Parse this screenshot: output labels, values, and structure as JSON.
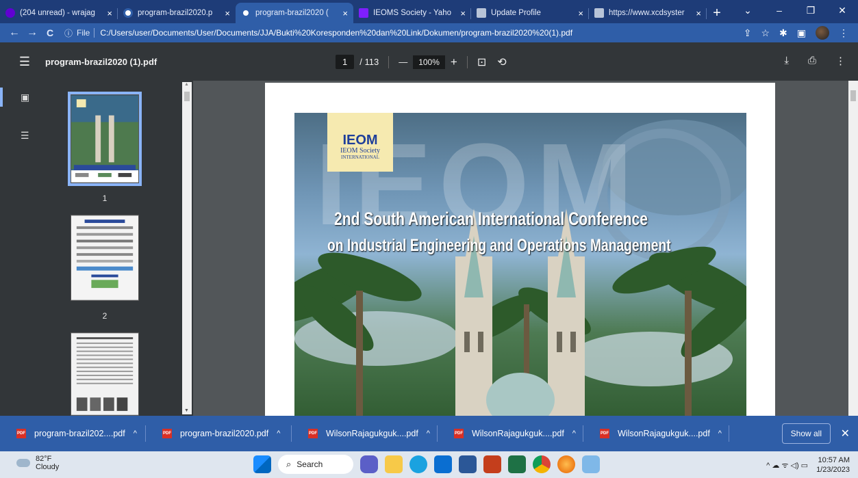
{
  "tabs": [
    {
      "title": "(204 unread) - wrajag",
      "favicon_color": "#6001d2",
      "active": false
    },
    {
      "title": "program-brazil2020.p",
      "favicon_color": "#ffffff",
      "active": false
    },
    {
      "title": "program-brazil2020 (",
      "favicon_color": "#ffffff",
      "active": true
    },
    {
      "title": "IEOMS Society - Yaho",
      "favicon_color": "#7e1fff",
      "active": false
    },
    {
      "title": "Update Profile",
      "favicon_color": "#b8c4d8",
      "active": false
    },
    {
      "title": "https://www.xcdsyster",
      "favicon_color": "#b8c4d8",
      "active": false
    }
  ],
  "tab_close": "×",
  "new_tab": "+",
  "window_controls": {
    "chevron": "⌄",
    "minimize": "–",
    "restore": "❐",
    "close": "✕"
  },
  "nav": {
    "back": "←",
    "forward": "→",
    "reload": "C"
  },
  "address": {
    "info_icon": "ⓘ",
    "scheme": "File",
    "url": "C:/Users/user/Documents/User/Documents/JJA/Bukti%20Koresponden%20dan%20Link/Dokumen/program-brazil2020%20(1).pdf"
  },
  "toolbar_icons": {
    "share": "⇪",
    "star": "☆",
    "extensions": "✱",
    "sidepanel": "▣",
    "menu": "⋮"
  },
  "pdf": {
    "menu_icon": "☰",
    "filename": "program-brazil2020 (1).pdf",
    "current_page": "1",
    "total_pages": "/ 113",
    "zoom_out": "—",
    "zoom": "100%",
    "zoom_in": "+",
    "fit_icon": "⊡",
    "rotate_icon": "⟲",
    "download_icon": "⤓",
    "print_icon": "⎙",
    "more_icon": "⋮"
  },
  "sidebar": {
    "thumbnails_icon": "▣",
    "outline_icon": "☰",
    "thumbs": [
      {
        "label": "1",
        "selected": true
      },
      {
        "label": "2",
        "selected": false
      },
      {
        "label": "",
        "selected": false
      }
    ],
    "scroll_up": "▲",
    "scroll_down": "▼"
  },
  "cover": {
    "logo_main": "IEOM",
    "logo_sub1": "IEOM Society",
    "logo_sub2": "INTERNATIONAL",
    "watermark": "IEOM",
    "title_line1": "2nd South American International Conference",
    "title_line2": "on Industrial Engineering and Operations Management"
  },
  "downloads": [
    {
      "name": "program-brazil202....pdf"
    },
    {
      "name": "program-brazil2020.pdf"
    },
    {
      "name": "WilsonRajagukguk....pdf"
    },
    {
      "name": "WilsonRajagukguk....pdf"
    },
    {
      "name": "WilsonRajagukguk....pdf"
    }
  ],
  "download_icon_text": "PDF",
  "download_chevron": "^",
  "show_all": "Show all",
  "downloads_close": "✕",
  "taskbar": {
    "temperature": "82°F",
    "condition": "Cloudy",
    "search": "Search",
    "time": "10:57 AM",
    "date": "1/23/2023",
    "tray_icons": "^  ☁  ᯤ  ◁)  ▭"
  },
  "colors": {
    "chrome_dark": "#1e3c78",
    "chrome_light": "#2f5ea8",
    "pdf_toolbar": "#323639",
    "viewer_bg": "#525659",
    "thumb_highlight": "#8ab4f8"
  }
}
